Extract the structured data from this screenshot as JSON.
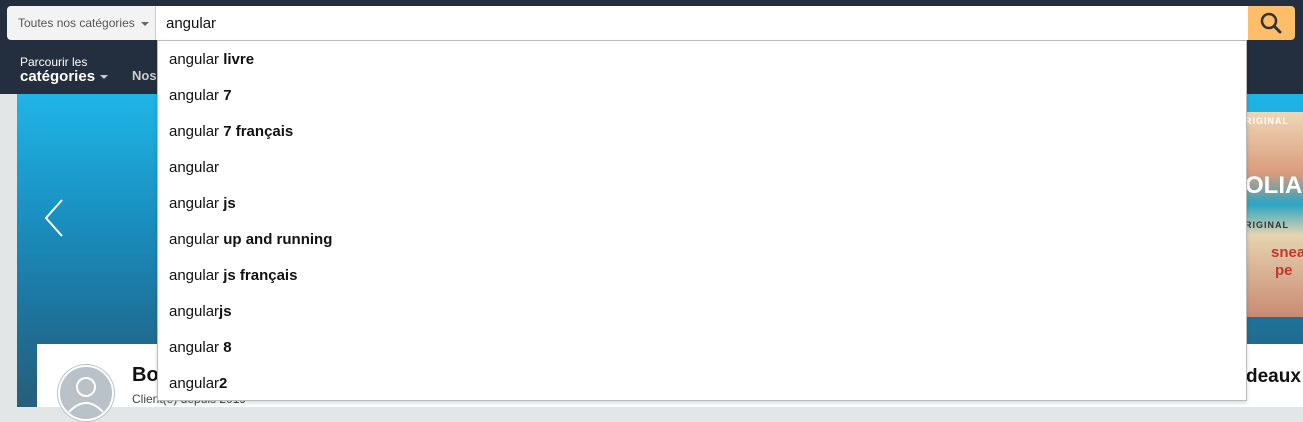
{
  "search": {
    "category_label": "Toutes nos catégories",
    "query": "angular"
  },
  "nav": {
    "browse_line1": "Parcourir les",
    "browse_line2": "catégories",
    "partial_link": "Nos"
  },
  "suggestions": [
    {
      "prefix": "angular ",
      "bold": "livre"
    },
    {
      "prefix": "angular ",
      "bold": "7"
    },
    {
      "prefix": "angular ",
      "bold": "7 français"
    },
    {
      "prefix": "angular",
      "bold": ""
    },
    {
      "prefix": "angular ",
      "bold": "js"
    },
    {
      "prefix": "angular ",
      "bold": "up and running"
    },
    {
      "prefix": "angular ",
      "bold": "js français"
    },
    {
      "prefix": "angular",
      "bold": "js"
    },
    {
      "prefix": "angular ",
      "bold": "8"
    },
    {
      "prefix": "angular",
      "bold": "2"
    }
  ],
  "page": {
    "card_title": "Bo",
    "card_sub": "Client(e) depuis 2019",
    "card2_title": "deaux",
    "poster_text_1": "RIGINAL",
    "poster_text_2": "OLIA",
    "poster_text_3": "RIGINAL",
    "poster_text_4": "snea",
    "poster_text_5": "pe"
  },
  "colors": {
    "nav_bg": "#232f3e",
    "search_button": "#febd69",
    "hero_blue": "#1fb5e6"
  },
  "icons": [
    "search-icon",
    "chevron-left-icon",
    "avatar-icon",
    "caret-down-icon"
  ]
}
